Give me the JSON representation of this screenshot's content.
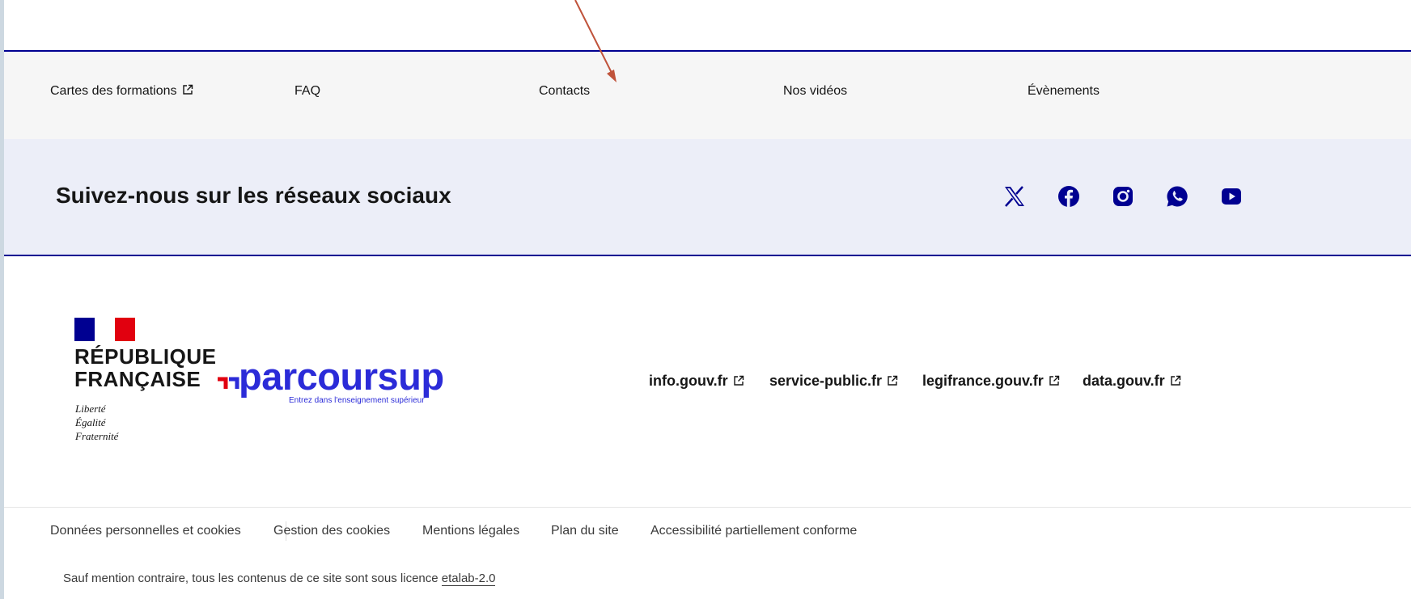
{
  "nav": {
    "items": [
      {
        "label": "Cartes des formations",
        "external": true
      },
      {
        "label": "FAQ",
        "external": false
      },
      {
        "label": "Contacts",
        "external": false
      },
      {
        "label": "Nos vidéos",
        "external": false
      },
      {
        "label": "Évènements",
        "external": false
      }
    ]
  },
  "social": {
    "title": "Suivez-nous sur les réseaux sociaux",
    "icons": [
      "x-icon",
      "facebook-icon",
      "instagram-icon",
      "whatsapp-icon",
      "youtube-icon"
    ]
  },
  "brand": {
    "republic_line1": "RÉPUBLIQUE",
    "republic_line2": "FRANÇAISE",
    "motto1": "Liberté",
    "motto2": "Égalité",
    "motto3": "Fraternité",
    "logo_word": "parcoursup",
    "logo_tagline": "Entrez dans l'enseignement supérieur"
  },
  "gov_links": [
    {
      "label": "info.gouv.fr"
    },
    {
      "label": "service-public.fr"
    },
    {
      "label": "legifrance.gouv.fr"
    },
    {
      "label": "data.gouv.fr"
    }
  ],
  "bottom_links": [
    {
      "label": "Données personnelles et cookies"
    },
    {
      "label": "Gestion des cookies"
    },
    {
      "label": "Mentions légales"
    },
    {
      "label": "Plan du site"
    },
    {
      "label": "Accessibilité partiellement conforme"
    }
  ],
  "licence": {
    "text": "Sauf mention contraire, tous les contenus de ce site sont sous licence ",
    "link": "etalab-2.0"
  },
  "colors": {
    "accent": "#000091",
    "parcoursup_blue": "#2b2bd8",
    "flag_red": "#e1000f",
    "annotation_arrow": "#c0533b"
  }
}
